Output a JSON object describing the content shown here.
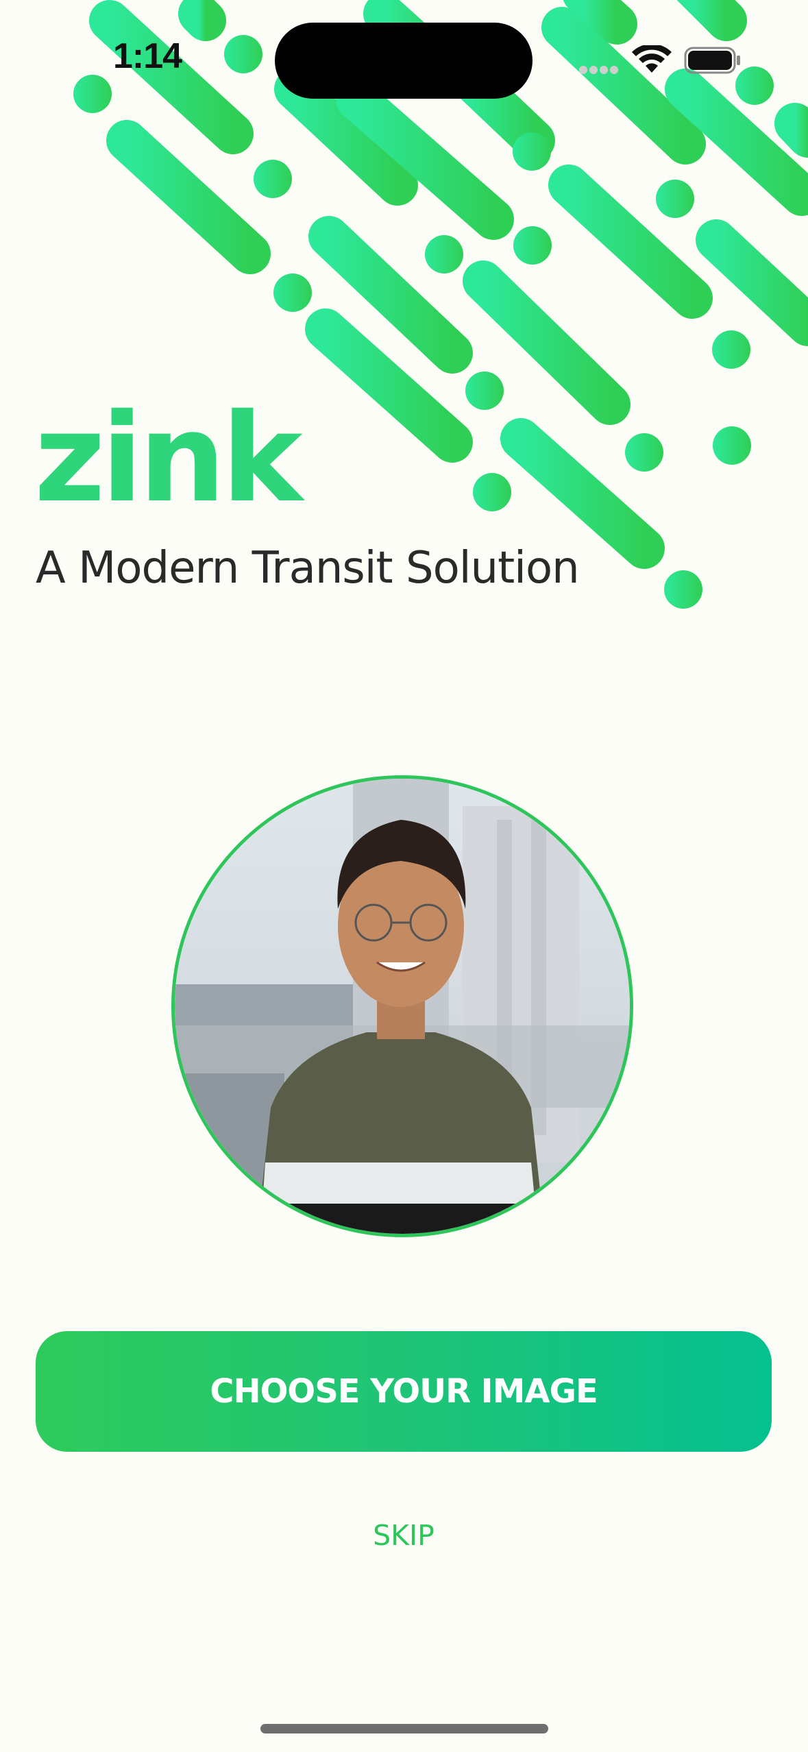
{
  "status_bar": {
    "time": "1:14",
    "icons": [
      "cellular-signal-icon",
      "wifi-icon",
      "battery-icon"
    ]
  },
  "brand": {
    "logo_text": "zink",
    "tagline": "A Modern Transit Solution",
    "accent_color": "#2fd57a"
  },
  "profile": {
    "image": "profile-photo",
    "ring_color": "#2ec55a"
  },
  "actions": {
    "choose_label": "CHOOSE YOUR IMAGE",
    "skip_label": "SKIP"
  },
  "colors": {
    "background": "#fdfdf8",
    "button_gradient_start": "#2ecb5c",
    "button_gradient_end": "#05c08f"
  }
}
